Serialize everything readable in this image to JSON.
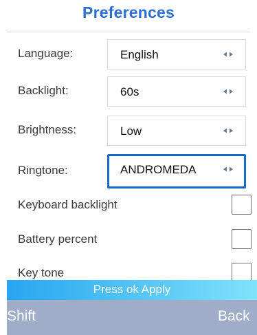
{
  "header": {
    "title": "Preferences"
  },
  "settings": {
    "language": {
      "label": "Language:",
      "value": "English"
    },
    "backlight": {
      "label": "Backlight:",
      "value": "60s"
    },
    "brightness": {
      "label": "Brightness:",
      "value": "Low"
    },
    "ringtone": {
      "label": "Ringtone:",
      "value": "ANDROMEDA"
    },
    "keyboard_backlight": {
      "label": "Keyboard backlight",
      "checked": false
    },
    "battery_percent": {
      "label": "Battery percent",
      "checked": false
    },
    "key_tone": {
      "label": "Key tone",
      "checked": false
    }
  },
  "apply_bar": {
    "text": "Press ok Apply"
  },
  "softkeys": {
    "left": "Shift",
    "right": "Back"
  },
  "colors": {
    "title": "#2b6fd0",
    "focus_border": "#1769c8",
    "apply_bar": "#27a6f0",
    "softkey_bar": "#9fadc8"
  },
  "icons": {
    "selector_arrows": "left-right-arrows-icon"
  }
}
